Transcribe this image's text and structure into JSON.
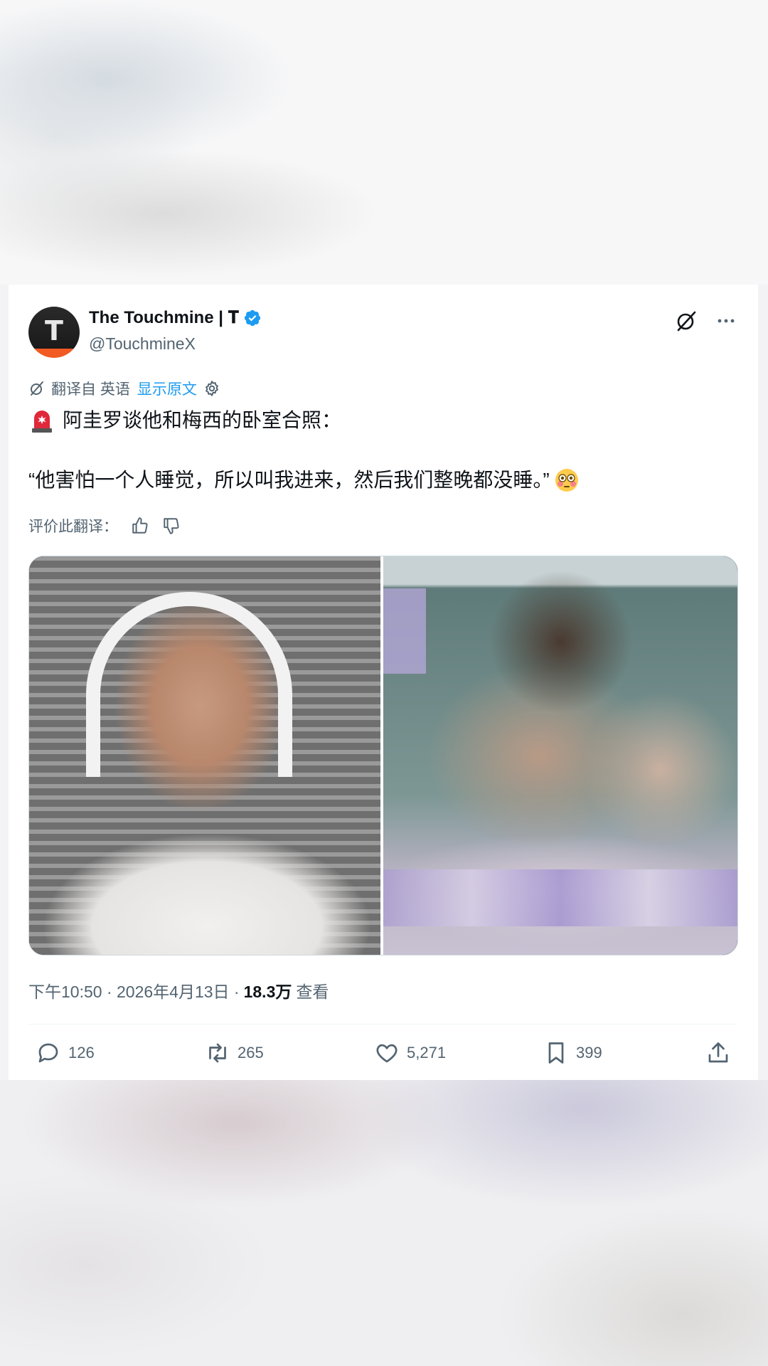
{
  "post": {
    "display_name": "The Touchmine | 𝐓",
    "handle": "@TouchmineX",
    "avatar_letter": "T",
    "translation": {
      "label": "翻译自 英语",
      "show_original": "显示原文"
    },
    "text_line1": "阿圭罗谈他和梅西的卧室合照：",
    "text_line2": "“他害怕一个人睡觉，所以叫我进来，然后我们整晚都没睡。”",
    "rate_label": "评价此翻译：",
    "timestamp": "下午10:50 · 2026年4月13日 ·",
    "views_count": "18.3万",
    "views_label": "查看",
    "stats": {
      "replies": "126",
      "reposts": "265",
      "likes": "5,271",
      "bookmarks": "399"
    }
  },
  "colors": {
    "accent": "#1d9bf0",
    "muted_text": "#536471",
    "text": "#0f1419",
    "avatar_orange": "#f15a22"
  }
}
